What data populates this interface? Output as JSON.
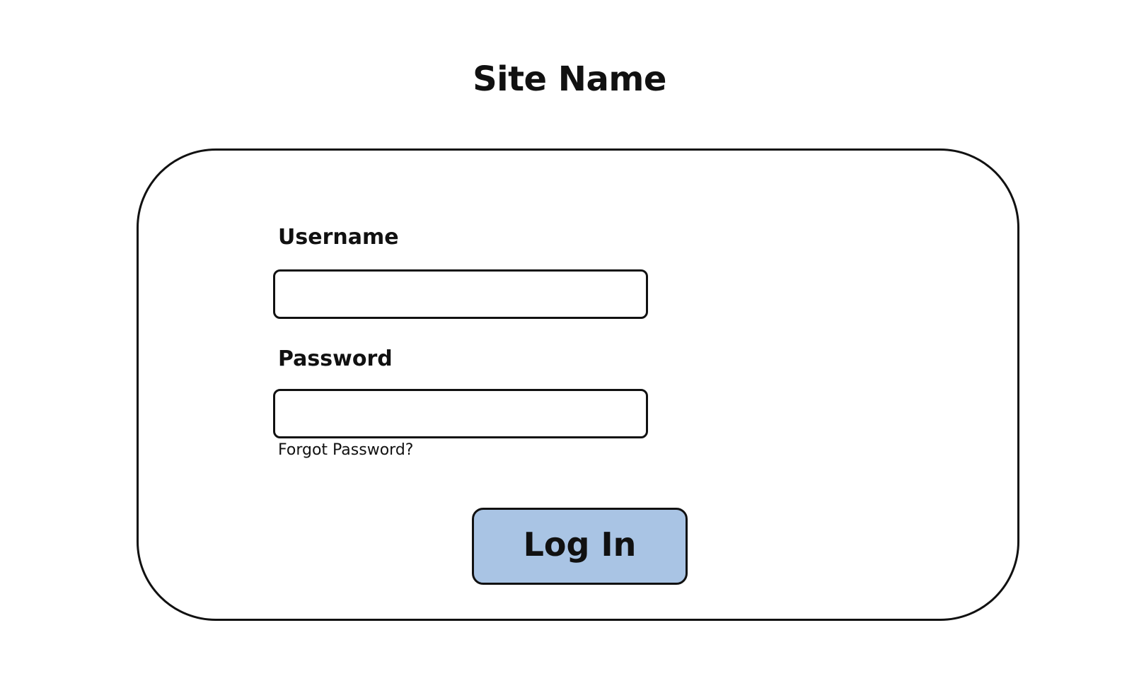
{
  "header": {
    "site_name": "Site Name"
  },
  "login_form": {
    "username_label": "Username",
    "username_value": "",
    "password_label": "Password",
    "password_value": "",
    "forgot_password_link": "Forgot Password?",
    "login_button_label": "Log In"
  },
  "colors": {
    "login_button_bg": "#a9c4e4",
    "border": "#111111",
    "background": "#ffffff"
  }
}
